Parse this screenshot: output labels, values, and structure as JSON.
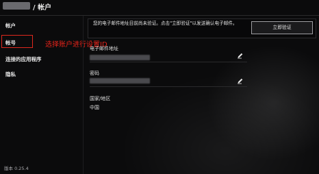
{
  "header": {
    "title": "/ 帐户"
  },
  "sidebar": {
    "items": [
      {
        "label": "帐户"
      },
      {
        "label": "帐号"
      },
      {
        "label": "连接的应用程序"
      },
      {
        "label": "隐私"
      }
    ],
    "version": "版本 0.25.4"
  },
  "annotation": {
    "text": "选择账户进行设置ID",
    "color": "#e5231a"
  },
  "notice": {
    "text": "您的电子邮件地址目前尚未验证。点击\"立即验证\"以发送确认电子邮件。",
    "button_label": "立即验证"
  },
  "fields": {
    "email_label": "电子邮件地址",
    "password_label": "密码",
    "country_label": "国家/地区",
    "country_value": "中国"
  },
  "icons": {
    "email_edit": "pencil-icon",
    "password_edit": "pencil-icon"
  }
}
